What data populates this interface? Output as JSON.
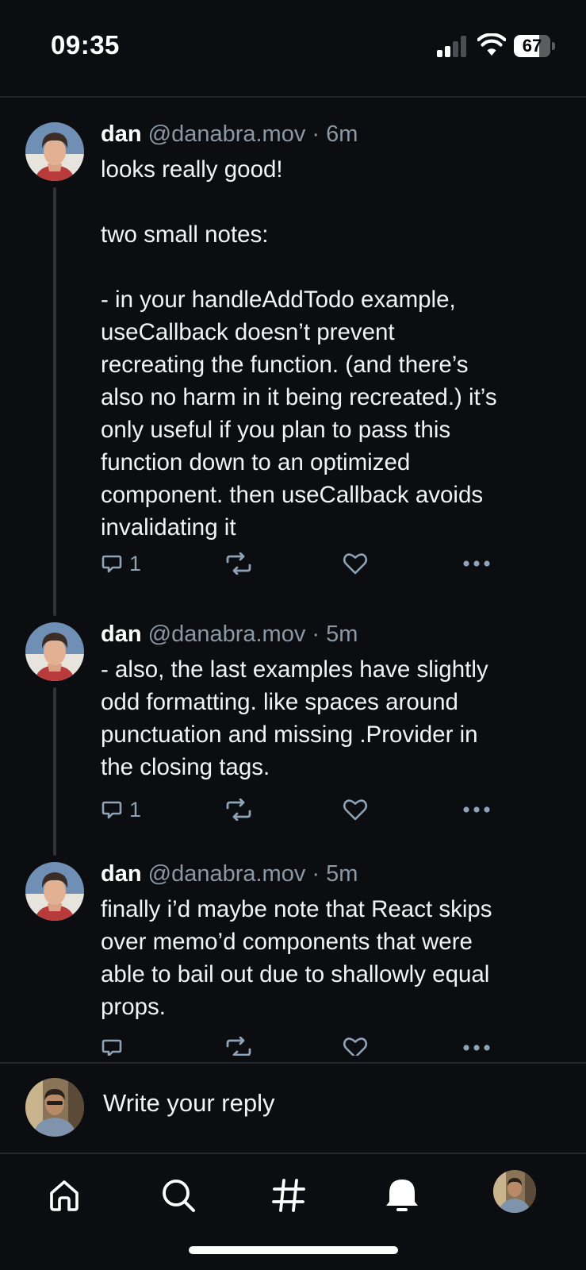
{
  "status_bar": {
    "time": "09:35",
    "battery_level": "67"
  },
  "posts": [
    {
      "author": "dan",
      "handle": "@danabra.mov",
      "age": "6m",
      "text": "looks really good!\n\ntwo small notes:\n\n- in your handleAddTodo example,\nuseCallback doesn’t prevent\nrecreating the function. (and there’s\nalso no harm in it being recreated.) it’s\nonly useful if you plan to pass this\nfunction down to an optimized\ncomponent. then useCallback avoids\ninvalidating it",
      "reply_count": "1"
    },
    {
      "author": "dan",
      "handle": "@danabra.mov",
      "age": "5m",
      "text": "- also, the last examples have slightly\nodd formatting. like spaces around\npunctuation and missing .Provider in\nthe closing tags.",
      "reply_count": "1"
    },
    {
      "author": "dan",
      "handle": "@danabra.mov",
      "age": "5m",
      "text": "finally i’d maybe note that React skips\nover memo’d components that were\nable to bail out due to shallowly equal\nprops.",
      "reply_count": ""
    }
  ],
  "separator": "·",
  "reply_bar": {
    "placeholder": "Write your reply"
  },
  "nav": {
    "items": [
      "home-icon",
      "search-icon",
      "feeds-hash-icon",
      "notifications-bell-icon",
      "profile-avatar"
    ]
  },
  "colors": {
    "background": "#0b0d10",
    "handle": "#8b98a5",
    "action_icon": "#8fa3b8",
    "divider": "#23272d"
  }
}
